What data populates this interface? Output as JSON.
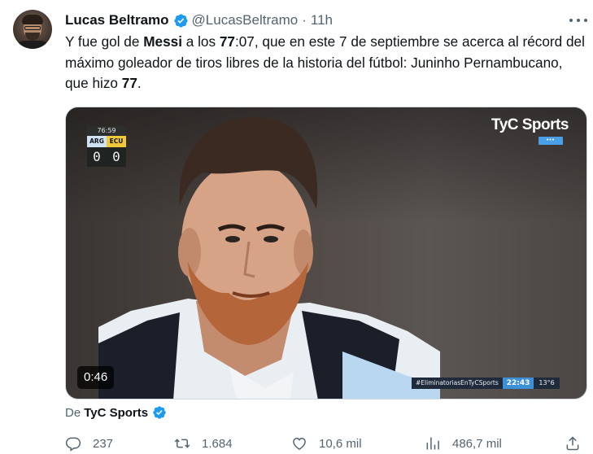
{
  "author": {
    "name": "Lucas Beltramo",
    "handle": "@LucasBeltramo",
    "separator": "·",
    "time": "11h"
  },
  "tweet": {
    "parts": [
      {
        "text": "Y fue gol de ",
        "bold": false
      },
      {
        "text": "Messi",
        "bold": true
      },
      {
        "text": " a los ",
        "bold": false
      },
      {
        "text": "77",
        "bold": true
      },
      {
        "text": ":07, que en este 7 de septiembre se acerca al récord del máximo goleador de tiros libres de la historia del fútbol: Juninho Pernambucano, que hizo ",
        "bold": false
      },
      {
        "text": "77",
        "bold": true
      },
      {
        "text": ".",
        "bold": false
      }
    ]
  },
  "media": {
    "scoreboard": {
      "clock": "76:59",
      "team_home": "ARG",
      "team_away": "ECU",
      "score_home": "0",
      "score_away": "0"
    },
    "broadcaster_logo": "TyC Sports",
    "flag_dots": "•••",
    "duration": "0:46",
    "ticker": {
      "hashtag": "#EliminatoriasEnTyCSports",
      "clock": "22:43",
      "temperature": "13°6"
    }
  },
  "source": {
    "prefix": "De",
    "name": "TyC Sports"
  },
  "actions": {
    "replies": "237",
    "retweets": "1.684",
    "likes": "10,6 mil",
    "views": "486,7 mil"
  },
  "icons": {
    "verified": "verified-badge-icon",
    "more": "more-options-icon",
    "reply": "reply-icon",
    "retweet": "retweet-icon",
    "like": "heart-icon",
    "views": "views-chart-icon",
    "share": "share-icon"
  },
  "colors": {
    "verified": "#1d9bf0",
    "secondary_text": "#536471",
    "primary_text": "#0f1419"
  }
}
